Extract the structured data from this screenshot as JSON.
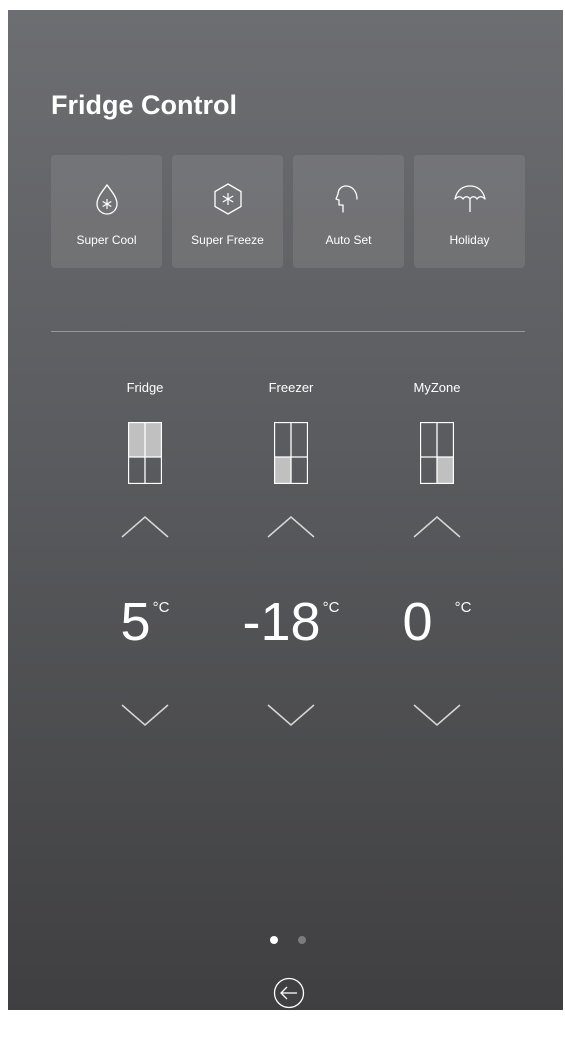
{
  "title": "Fridge Control",
  "modes": [
    {
      "label": "Super Cool",
      "icon": "droplet-snowflake-icon"
    },
    {
      "label": "Super Freeze",
      "icon": "hexagon-snowflake-icon"
    },
    {
      "label": "Auto Set",
      "icon": "head-profile-icon"
    },
    {
      "label": "Holiday",
      "icon": "umbrella-icon"
    }
  ],
  "zones": [
    {
      "label": "Fridge",
      "temperature": "5",
      "unit": "°C",
      "icon": "fridge-compartment-top-icon"
    },
    {
      "label": "Freezer",
      "temperature": "-18",
      "unit": "°C",
      "icon": "freezer-compartment-icon"
    },
    {
      "label": "MyZone",
      "temperature": "0",
      "unit": "°C",
      "icon": "myzone-compartment-icon"
    }
  ],
  "pagination": {
    "pages": 2,
    "current": 1
  },
  "colors": {
    "background_top": "#6d6e71",
    "background_bottom": "#3f3f41",
    "highlight": "#c0c0c0",
    "text": "#ffffff"
  }
}
